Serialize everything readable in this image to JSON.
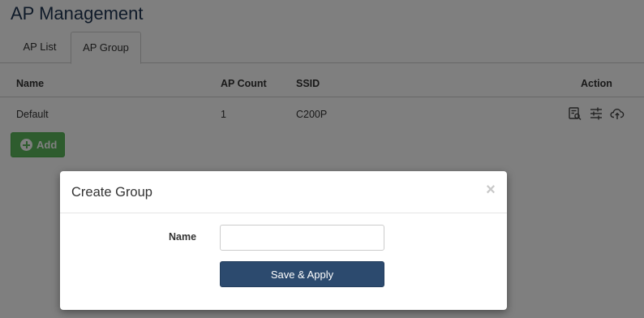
{
  "page": {
    "title": "AP Management"
  },
  "tabs": [
    {
      "label": "AP List",
      "active": false
    },
    {
      "label": "AP Group",
      "active": true
    }
  ],
  "table": {
    "headers": {
      "name": "Name",
      "ap_count": "AP Count",
      "ssid": "SSID",
      "action": "Action"
    },
    "rows": [
      {
        "name": "Default",
        "ap_count": "1",
        "ssid": "C200P"
      }
    ],
    "row_actions": [
      "view-details-icon",
      "settings-sliders-icon",
      "cloud-upload-icon"
    ]
  },
  "add_button": {
    "label": "Add",
    "icon": "plus-circle-icon"
  },
  "modal": {
    "title": "Create Group",
    "close_symbol": "×",
    "fields": {
      "name_label": "Name",
      "name_value": "",
      "name_placeholder": ""
    },
    "submit_label": "Save & Apply"
  },
  "colors": {
    "title": "#1f3552",
    "add_button": "#5cb85c",
    "save_button": "#2c4a6e",
    "overlay": "rgba(0,0,0,0.5)"
  }
}
